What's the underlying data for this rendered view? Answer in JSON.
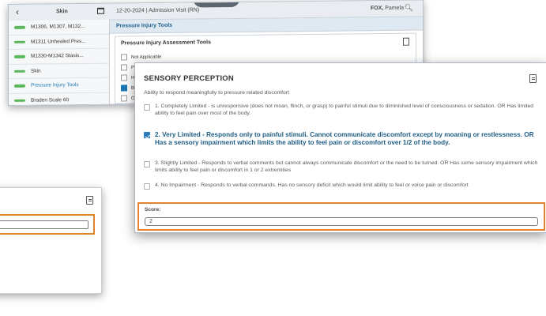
{
  "back_window": {
    "header": {
      "section": "Skin",
      "visit": "12-20-2024 | Admission Visit (RN)",
      "patient_last": "FOX,",
      "patient_first": "Pamela"
    },
    "sidebar": {
      "items": [
        {
          "label": "M1306, M1307, M132..."
        },
        {
          "label": "M1311 Unhealed Pres..."
        },
        {
          "label": "M1330-M1342 Stasis..."
        },
        {
          "label": "Skin"
        },
        {
          "label": "Pressure Injury Tools"
        },
        {
          "label": "Braden Scale 60"
        }
      ]
    },
    "main_title": "Pressure Injury Tools",
    "tools": {
      "title": "Pressure Injury Assessment Tools",
      "options": [
        {
          "label": "Not Applicable",
          "checked": false
        },
        {
          "label": "P",
          "checked": false
        },
        {
          "label": "H",
          "checked": false
        },
        {
          "label": "B",
          "checked": true
        },
        {
          "label": "O",
          "checked": false
        }
      ]
    }
  },
  "sensory": {
    "title": "SENSORY PERCEPTION",
    "description": "Ability to respond meaningfully to pressure related discomfort",
    "choices": [
      {
        "text": "1. Completely Limited - is unresponsive (does not moan, flinch, or grasp) to painful stimuli due to diminished level of consciousness or sedation. OR Has limited ability to feel pain over most of the body.",
        "checked": false
      },
      {
        "text": "2. Very Limited - Responds only to painful stimuli. Cannot communicate discomfort except by moaning or restlessness. OR Has a sensory impairment which limits the ability to feel pain or discomfort over 1/2 of the body.",
        "checked": true
      },
      {
        "text": "3. Slightly Limited - Responds to verbal comments but cannot always communicate discomfort or the need to be turned. OR Has some sensory impairment which limits ability to feel pain or discomfort in 1 or 2 extremities",
        "checked": false
      },
      {
        "text": "4. No Impairment - Responds to verbal commands. Has no sensory deficit which would limit ability to feel or voice pain or discomfort",
        "checked": false
      }
    ],
    "score_label": "Score:",
    "score_value": "2"
  },
  "colors": {
    "highlight": "#e4832f",
    "selected_text": "#1e5d85",
    "checkbox_on": "#2a7bb8",
    "sidebar_pill": "#5cb85c"
  },
  "icons": [
    "chevron-left-icon",
    "calendar-icon",
    "search-icon",
    "document-icon",
    "checkbox-icon"
  ]
}
